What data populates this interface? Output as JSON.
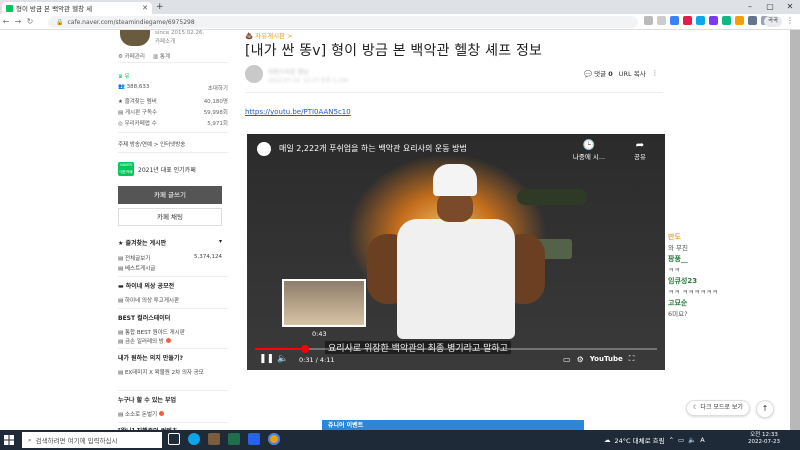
{
  "browser": {
    "tab_title": "형이 방금 본 백악관 헬창 세",
    "url": "cafe.naver.com/steamindiegame/6975298",
    "profile_label": "곡곡",
    "colors": {
      "tabbar": "#dee1e6",
      "accent": "#03c75a"
    }
  },
  "sidebar": {
    "since": "since 2015.02.26.",
    "intro": "카페소개",
    "admin": "카페관리",
    "stats": "통계",
    "member_count": "388,633",
    "invite": "초대하기",
    "rows": [
      {
        "label": "즐겨찾는 멤버",
        "value": "40,180명"
      },
      {
        "label": "게시판 구독수",
        "value": "59,998회"
      },
      {
        "label": "우리카페앱 수",
        "value": "5,971회"
      }
    ],
    "topic": "주제 방송/연예 > 인터넷방송",
    "badge_text": "2021년 대표 인기카페",
    "badge_icon": "NAVER 대표카페",
    "write_button": "카페 글쓰기",
    "chat_button": "카페 채팅",
    "favorite_board": "즐겨찾는 게시판",
    "all_posts": "전체글보기",
    "all_posts_count": "5,374,124",
    "best_posts": "베스트게시글",
    "sections": [
      {
        "heading": "하이네 의상 공모전",
        "link": "하이네 의상 투고게시판"
      },
      {
        "heading": "BEST 컬러스테이터",
        "link": "통합 BEST 원야드 게시판",
        "link2": "금손 일러레의 방"
      },
      {
        "heading": "내가 원하는 의지 만들기?",
        "link": "EX데미지 X 왁물원 2차 의자 공모"
      },
      {
        "heading": "누구나 할 수 있는 부업",
        "link": "소소로 돈벌기"
      },
      {
        "heading": "[왁나] 진행중인 컨텐츠",
        "link": ""
      }
    ]
  },
  "article": {
    "board_link": "자유게시판 >",
    "title": "[내가 싼 똥v] 형이 방금 본 백악관 헬창 셰프 정보",
    "author_name": "자랑스러운 형님",
    "author_meta": "2022.07.23. 12:27 조회 1,234",
    "comment_label": "댓글",
    "comment_count": "0",
    "url_copy": "URL 복사",
    "youtube_link": "https://youtu.be/PTI0AAN5c10"
  },
  "video": {
    "title": "매일 2,222개 푸쉬업을 하는 백악관 요리사의 운동 방법",
    "watch_later": "나중에 시...",
    "share": "공유",
    "preview_time": "0:43",
    "caption": "요리사로 위장한 백악관의 최종 병기라고 말하고",
    "time": "0:31 / 4:11",
    "brand": "YouTube",
    "progress": 0.124,
    "progress_color": "#ff0000"
  },
  "ad": {
    "text": "쥬니어 이벤트"
  },
  "chat": [
    {
      "name": "만도",
      "msg": "와 무친",
      "color": "#e6a23c"
    },
    {
      "name": "팡풍__",
      "msg": "ㅋㅋ",
      "color": "#2b7a3e"
    },
    {
      "name": "임큐성23",
      "msg": "ㅋㅋ ㅋㅋㅋㅋㅋㅋ",
      "color": "#2b7a3e"
    },
    {
      "name": "고묘순",
      "msg": "6미요?",
      "color": "#2b7a3e"
    }
  ],
  "floating": {
    "dark_mode": "다크 모드로 보기",
    "scroll_top_icon": "arrow-up-icon"
  },
  "taskbar": {
    "search_placeholder": "검색하려면 여기에 입력하십시",
    "weather": "24°C 대체로 흐림",
    "clock_time": "오전 12:33",
    "clock_date": "2022-07-23"
  }
}
